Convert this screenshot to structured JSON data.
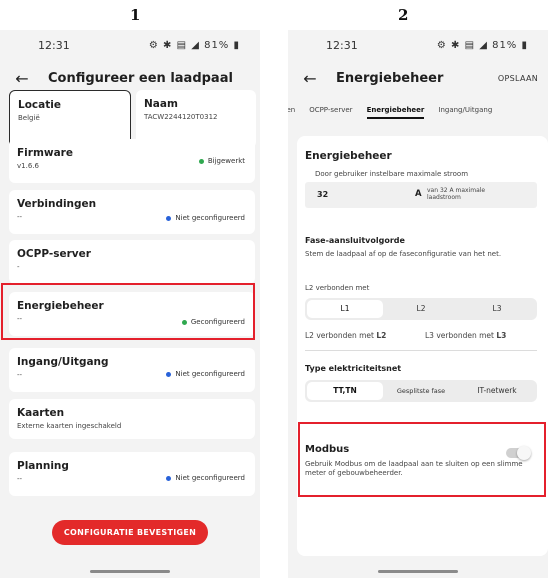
{
  "steps": [
    "1",
    "2"
  ],
  "status_bar": {
    "time": "12:31",
    "battery": "81%"
  },
  "screen1": {
    "title": "Configureer een laadpaal",
    "location": {
      "title": "Locatie",
      "value": "België"
    },
    "name": {
      "title": "Naam",
      "value": "TACW2244120T0312"
    },
    "cards": [
      {
        "title": "Firmware",
        "sub": "v1.6.6",
        "status": "Bijgewerkt",
        "status_color": "#2fa84f"
      },
      {
        "title": "Verbindingen",
        "sub": "--",
        "status": "Niet geconfigureerd",
        "status_color": "#2962d9"
      },
      {
        "title": "OCPP-server",
        "sub": "-",
        "status": "",
        "status_color": ""
      },
      {
        "title": "Energiebeheer",
        "sub": "--",
        "status": "Geconfigureerd",
        "status_color": "#2fa84f"
      },
      {
        "title": "Ingang/Uitgang",
        "sub": "--",
        "status": "Niet geconfigureerd",
        "status_color": "#2962d9"
      },
      {
        "title": "Kaarten",
        "sub": "Externe kaarten ingeschakeld",
        "status": "",
        "status_color": ""
      },
      {
        "title": "Planning",
        "sub": "--",
        "status": "Niet geconfigureerd",
        "status_color": "#2962d9"
      }
    ],
    "confirm_button": "CONFIGURATIE BEVESTIGEN"
  },
  "screen2": {
    "title": "Energiebeheer",
    "save": "OPSLAAN",
    "tabs": [
      "gen",
      "OCPP-server",
      "Energiebeheer",
      "Ingang/Uitgang"
    ],
    "section_title": "Energiebeheer",
    "max_current_label": "Door gebruiker instelbare maximale stroom",
    "max_current_value": "32",
    "unit": "A",
    "max_current_hint": "van 32 A maximale laadstroom",
    "phase_title": "Fase-aansluitvolgorde",
    "phase_desc": "Stem de laadpaal af op de faseconfiguratie van het net.",
    "l2_connected_label": "L2 verbonden met",
    "phase_options": [
      "L1",
      "L2",
      "L3"
    ],
    "l2_connected_text": "L2 verbonden met",
    "l2_connected_value": "L2",
    "l3_connected_text": "L3 verbonden met",
    "l3_connected_value": "L3",
    "grid_title": "Type elektriciteitsnet",
    "grid_options": [
      "TT,TN",
      "Gesplitste fase",
      "IT-netwerk"
    ],
    "modbus_title": "Modbus",
    "modbus_desc": "Gebruik Modbus om de laadpaal aan te sluiten op een slimme meter of gebouwbeheerder.",
    "modbus_enabled": false
  },
  "colors": {
    "accent_red": "#e32a2a",
    "highlight_red": "#e4202c"
  }
}
